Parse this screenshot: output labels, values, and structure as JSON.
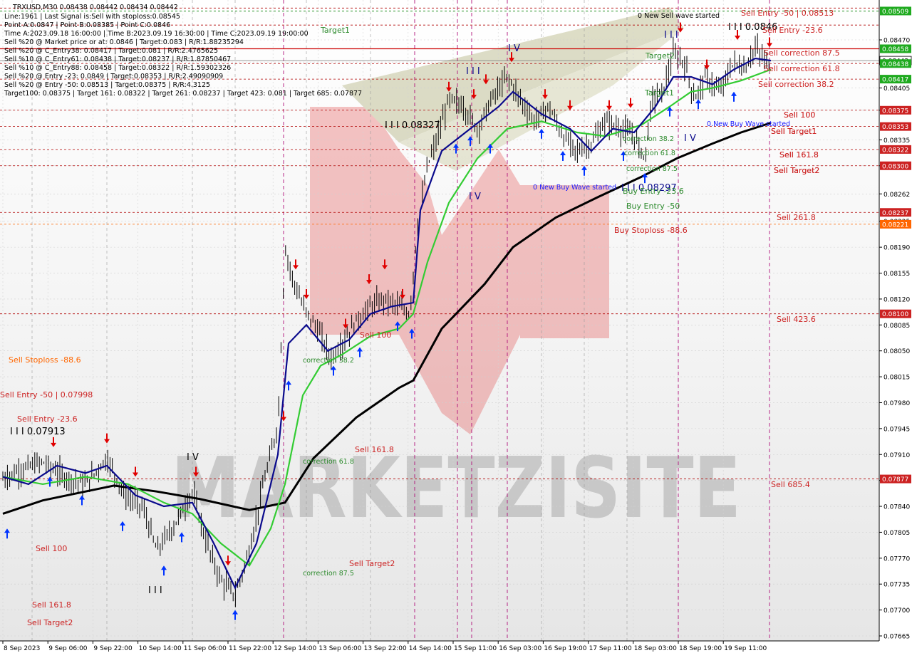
{
  "header": {
    "symbol_line": "TRXUSD,M30  0.08438 0.08442 0.08434 0.08442",
    "lines": [
      "Line:1961 | Last Signal is:Sell with stoploss:0.08545",
      "Point A:0.0847 | Point B:0.08385 | Point C:0.0846",
      "Time A:2023.09.18 16:00:00 | Time B:2023.09.19 16:30:00 | Time C:2023.09.19 19:00:00",
      "Sell %20 @ Market price or at: 0.0846 | Target:0.083 | R/R:1.88235294",
      "Sell %20 @ C_Entry38: 0.08417 | Target:0.081 | R/R:2.4765625",
      "Sell %10 @ C_Entry61: 0.08438 | Target:0.08237 | R/R:1.87850467",
      "Sell %10 @ C_Entry88: 0.08458 | Target:0.08322 | R/R:1.59302326",
      "Sell %20 @ Entry -23: 0.0849 | Target:0.08353 | R/R:2.49090909",
      "Sell %20 @ Entry -50: 0.08513 | Target:0.08375 | R/R:4.3125",
      "Target100: 0.08375 | Target 161: 0.08322 | Target 261: 0.08237 | Target 423: 0.081 | Target 685: 0.07877"
    ]
  },
  "watermark": "MARKETZISITE",
  "colors": {
    "ema_black": "#000000",
    "ema_green": "#33cc33",
    "ema_navy": "#0a0a8c",
    "sell_arrow": "#e00000",
    "buy_arrow": "#0033ff",
    "level_red": "#c00000",
    "level_green": "#008000",
    "axis_tag_green": "#1faa1f",
    "axis_tag_red": "#cc2222",
    "axis_tag_orange": "#ff6600",
    "current_price_tag": "#ffffff"
  },
  "chart_data": {
    "type": "candlestick",
    "y_axis": {
      "ticks": [
        "0.08470",
        "0.08440",
        "0.08405",
        "0.08375",
        "0.08335",
        "0.08300",
        "0.08262",
        "0.08225",
        "0.08190",
        "0.08155",
        "0.08120",
        "0.08085",
        "0.08050",
        "0.08015",
        "0.07980",
        "0.07945",
        "0.07910",
        "0.07875",
        "0.07840",
        "0.07805",
        "0.07770",
        "0.07735",
        "0.07700",
        "0.07665"
      ],
      "tags": [
        {
          "value": "0.08509",
          "color": "green"
        },
        {
          "value": "0.08458",
          "color": "green"
        },
        {
          "value": "0.08442",
          "color": "current"
        },
        {
          "value": "0.08438",
          "color": "green"
        },
        {
          "value": "0.08417",
          "color": "green"
        },
        {
          "value": "0.08375",
          "color": "red"
        },
        {
          "value": "0.08353",
          "color": "red"
        },
        {
          "value": "0.08322",
          "color": "red"
        },
        {
          "value": "0.08300",
          "color": "red"
        },
        {
          "value": "0.08237",
          "color": "red"
        },
        {
          "value": "0.08221",
          "color": "orange"
        },
        {
          "value": "0.08100",
          "color": "red"
        },
        {
          "value": "0.07877",
          "color": "red"
        }
      ]
    },
    "x_axis": {
      "ticks": [
        "8 Sep 2023",
        "9 Sep 06:00",
        "9 Sep 22:00",
        "10 Sep 14:00",
        "11 Sep 06:00",
        "11 Sep 22:00",
        "12 Sep 14:00",
        "13 Sep 06:00",
        "13 Sep 22:00",
        "14 Sep 14:00",
        "15 Sep 11:00",
        "16 Sep 03:00",
        "16 Sep 19:00",
        "17 Sep 11:00",
        "18 Sep 03:00",
        "18 Sep 19:00",
        "19 Sep 11:00"
      ]
    },
    "levels_right": [
      {
        "label": "Sell Entry -50 | 0.08513",
        "value": 0.08513,
        "color": "red"
      },
      {
        "label": "Sell Entry -23.6",
        "value": 0.0849,
        "color": "red"
      },
      {
        "label": "Sell correction 87.5",
        "value": 0.08458,
        "color": "red"
      },
      {
        "label": "Sell correction 61.8",
        "value": 0.08438,
        "color": "red"
      },
      {
        "label": "Sell correction 38.2",
        "value": 0.08417,
        "color": "red"
      },
      {
        "label": "Sell 100",
        "value": 0.08375,
        "color": "red"
      },
      {
        "label": "Sell Target1",
        "value": 0.08353,
        "color": "red"
      },
      {
        "label": "Sell 161.8",
        "value": 0.08322,
        "color": "red"
      },
      {
        "label": "Sell Target2",
        "value": 0.083,
        "color": "red"
      },
      {
        "label": "Sell 261.8",
        "value": 0.08237,
        "color": "red"
      },
      {
        "label": "Sell 423.6",
        "value": 0.081,
        "color": "red"
      },
      {
        "label": "Sell 685.4",
        "value": 0.07877,
        "color": "red"
      }
    ],
    "annotations": [
      {
        "text": "0 New Sell wave started",
        "color": "black"
      },
      {
        "text": "I I I 0.0846",
        "color": "black"
      },
      {
        "text": "I I I 0.08327",
        "color": "black"
      },
      {
        "text": "I I I 0.08297",
        "color": "navy"
      },
      {
        "text": "I I I 0.07913",
        "color": "black"
      },
      {
        "text": "0 New Buy Wave started",
        "color": "blue"
      },
      {
        "text": "0.New Buy Wave started",
        "color": "blue"
      },
      {
        "text": "Target1",
        "color": "green"
      },
      {
        "text": "Target2",
        "color": "green"
      },
      {
        "text": "Target1",
        "color": "green"
      },
      {
        "text": "Buy Entry -23.6",
        "color": "green"
      },
      {
        "text": "Buy Entry -50",
        "color": "green"
      },
      {
        "text": "Buy Stoploss -88.6",
        "color": "red"
      },
      {
        "text": "correction 38.2",
        "color": "green"
      },
      {
        "text": "correction 61.8",
        "color": "green"
      },
      {
        "text": "correction 87.5",
        "color": "green"
      },
      {
        "text": "correction 38.2",
        "color": "green"
      },
      {
        "text": "correction 61.8",
        "color": "green"
      },
      {
        "text": "correction 87.5",
        "color": "green"
      },
      {
        "text": "Sell 100",
        "color": "red"
      },
      {
        "text": "Sell 161.8",
        "color": "red"
      },
      {
        "text": "Sell Target2",
        "color": "red"
      },
      {
        "text": "Sell 100",
        "color": "red"
      },
      {
        "text": "Sell 161.8",
        "color": "red"
      },
      {
        "text": "Sell Target2",
        "color": "red"
      },
      {
        "text": "Sell Stoploss -88.6",
        "color": "orange"
      },
      {
        "text": "Sell Entry -50 | 0.07998",
        "color": "red"
      },
      {
        "text": "Sell Entry -23.6",
        "color": "red"
      },
      {
        "text": "I V",
        "color": "black"
      },
      {
        "text": "I V",
        "color": "navy"
      },
      {
        "text": "I V",
        "color": "navy"
      },
      {
        "text": "I I I",
        "color": "black"
      }
    ]
  }
}
